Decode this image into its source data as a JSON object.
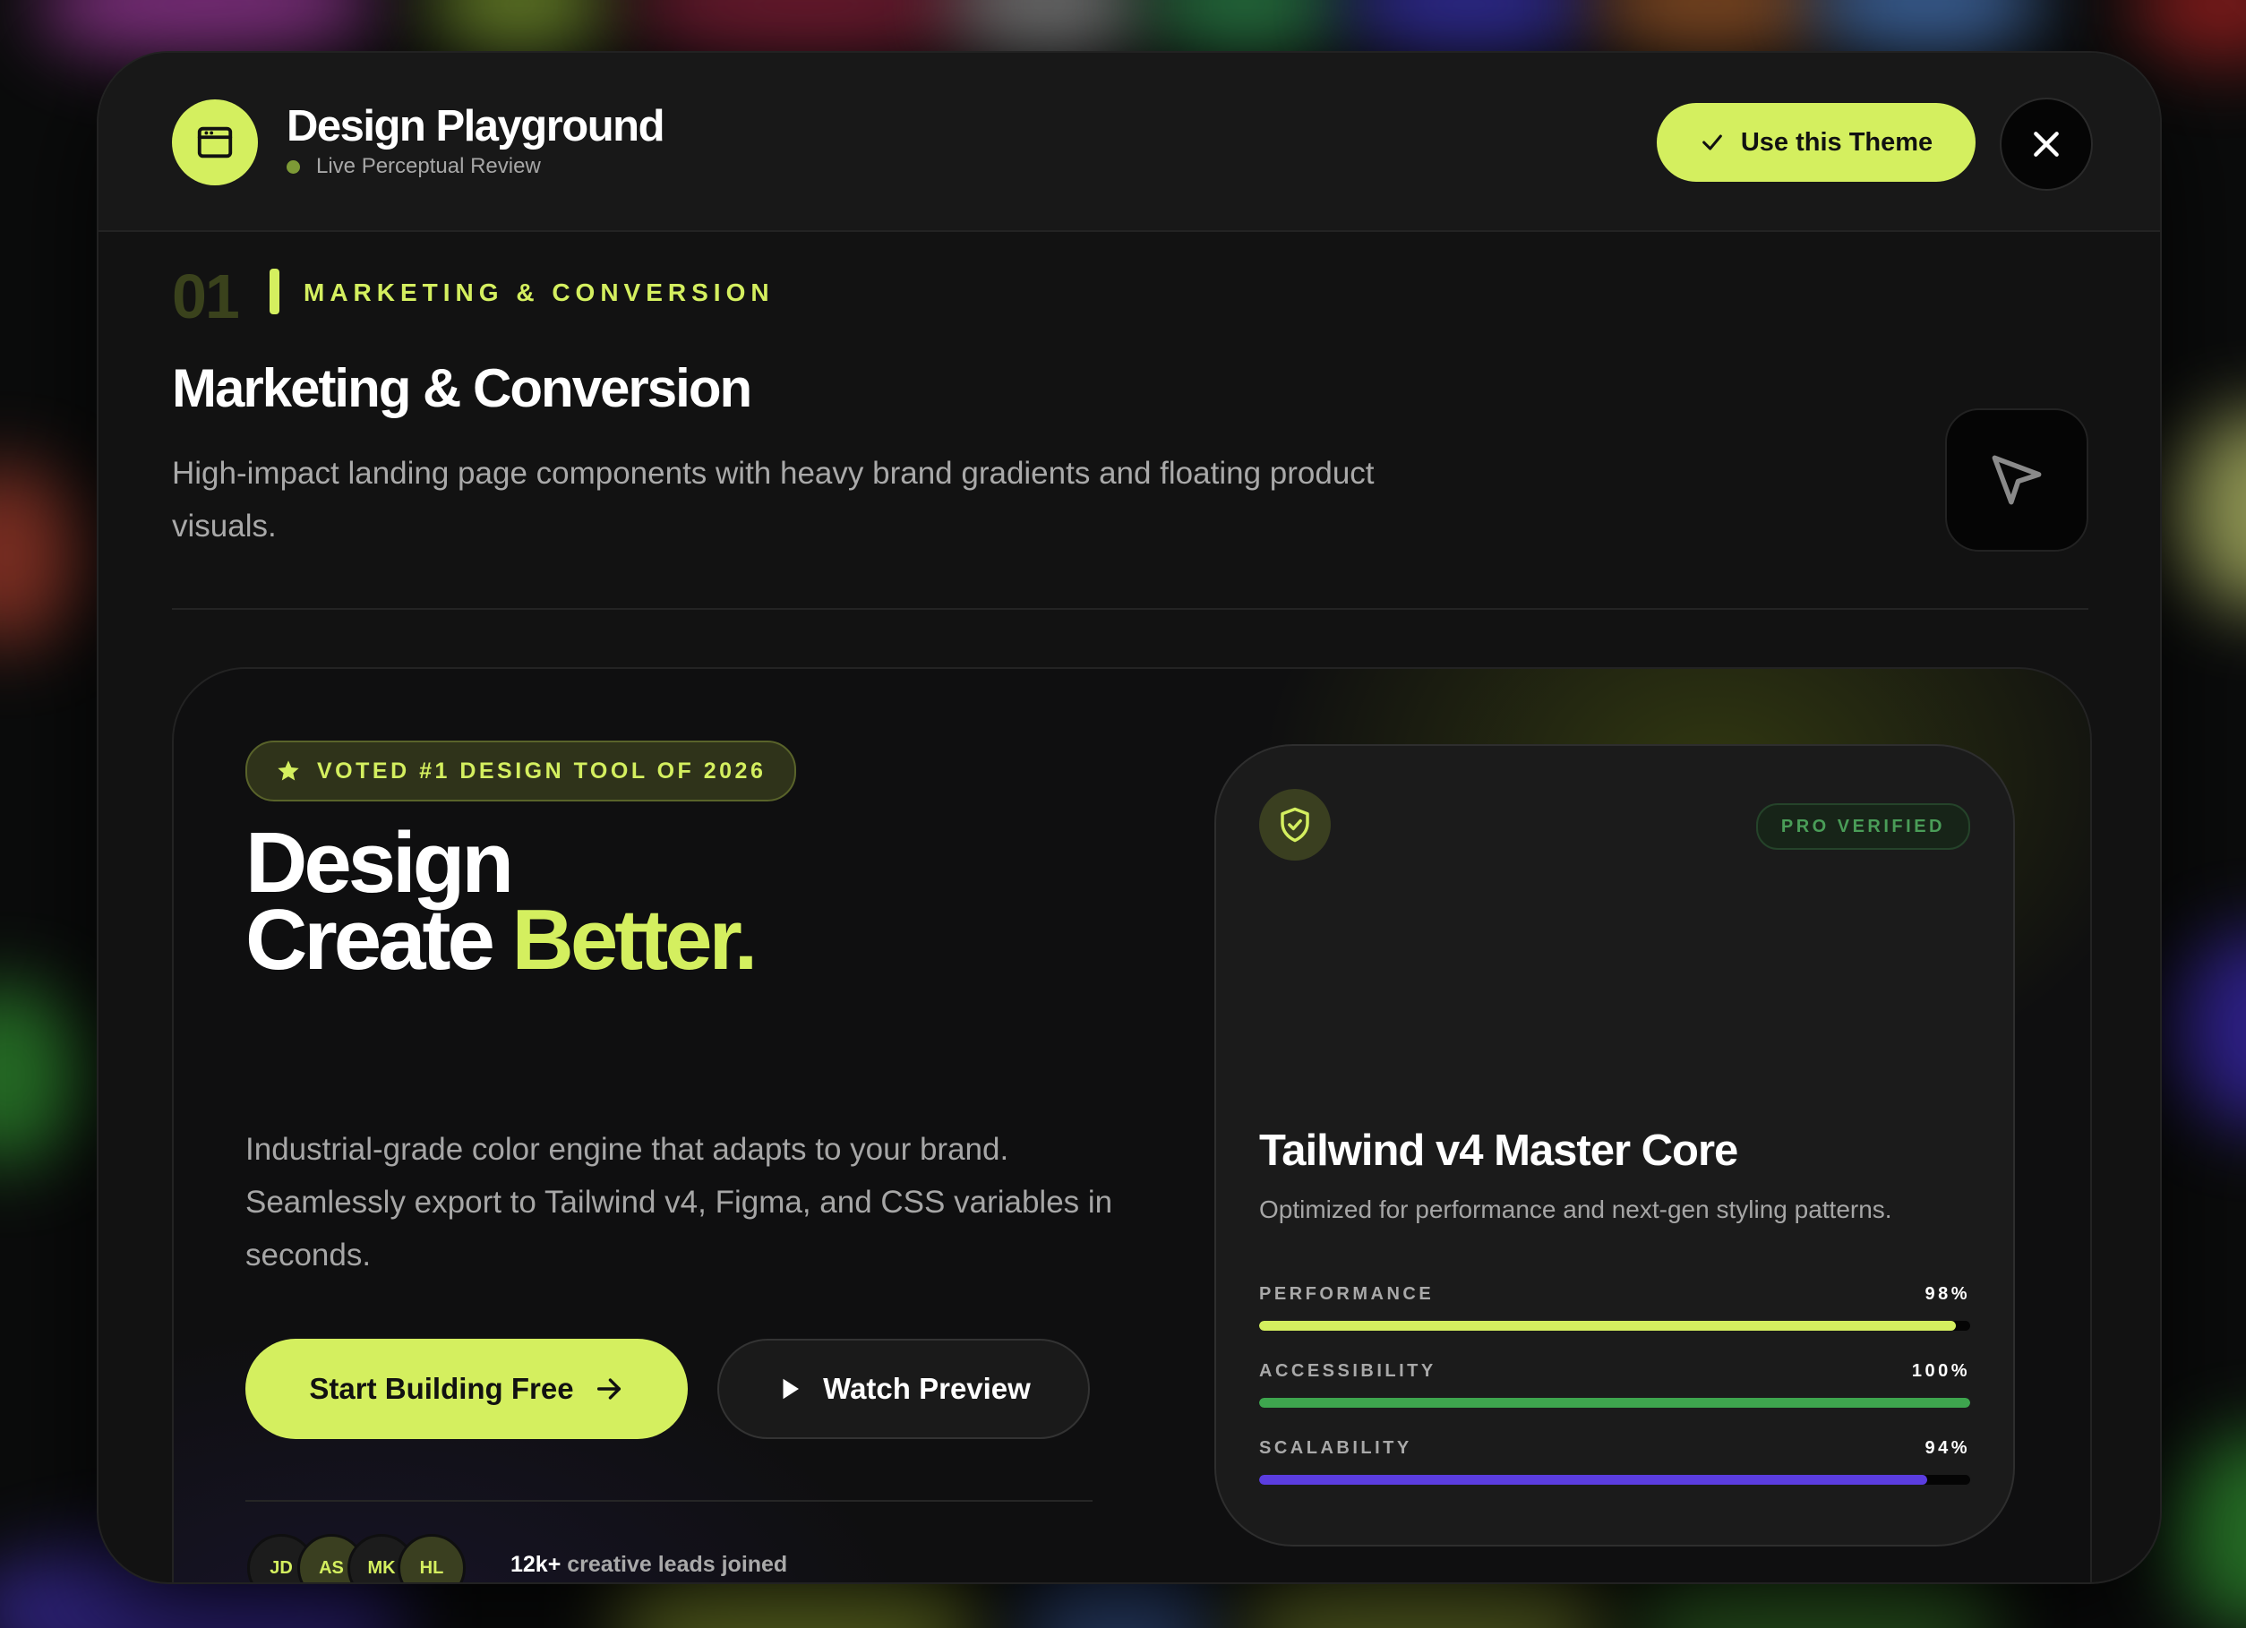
{
  "colors": {
    "accent": "#d4ef5f",
    "performance": "#d4ef5f",
    "accessibility": "#3ea54e",
    "scalability": "#5b3de0",
    "verified": "#4a9d58"
  },
  "header": {
    "title": "Design Playground",
    "subtitle": "Live Perceptual Review",
    "use_theme_label": "Use this Theme",
    "app_icon": "browser-window-icon",
    "close_icon": "close-icon"
  },
  "section": {
    "number": "01",
    "tag": "MARKETING & CONVERSION",
    "title": "Marketing & Conversion",
    "description": "High-impact landing page components with heavy brand gradients and floating product visuals.",
    "icon": "cursor-arrow-icon"
  },
  "hero": {
    "badge": "VOTED #1 DESIGN TOOL OF 2026",
    "headline_line1": "Design",
    "headline_line2_plain": "Create ",
    "headline_line2_accent": "Better.",
    "description": "Industrial-grade color engine that adapts to your brand. Seamlessly export to Tailwind v4, Figma, and CSS variables in seconds.",
    "primary_cta": "Start Building Free",
    "secondary_cta": "Watch Preview",
    "avatars": [
      "JD",
      "AS",
      "MK",
      "HL"
    ],
    "social_proof_count": "12k+",
    "social_proof_text": " creative leads joined"
  },
  "card": {
    "badge": "PRO VERIFIED",
    "title": "Tailwind v4 Master Core",
    "description": "Optimized for performance and next-gen styling patterns.",
    "metrics": [
      {
        "label": "PERFORMANCE",
        "value": "98%",
        "percent": 98
      },
      {
        "label": "ACCESSIBILITY",
        "value": "100%",
        "percent": 100
      },
      {
        "label": "SCALABILITY",
        "value": "94%",
        "percent": 94
      }
    ]
  }
}
